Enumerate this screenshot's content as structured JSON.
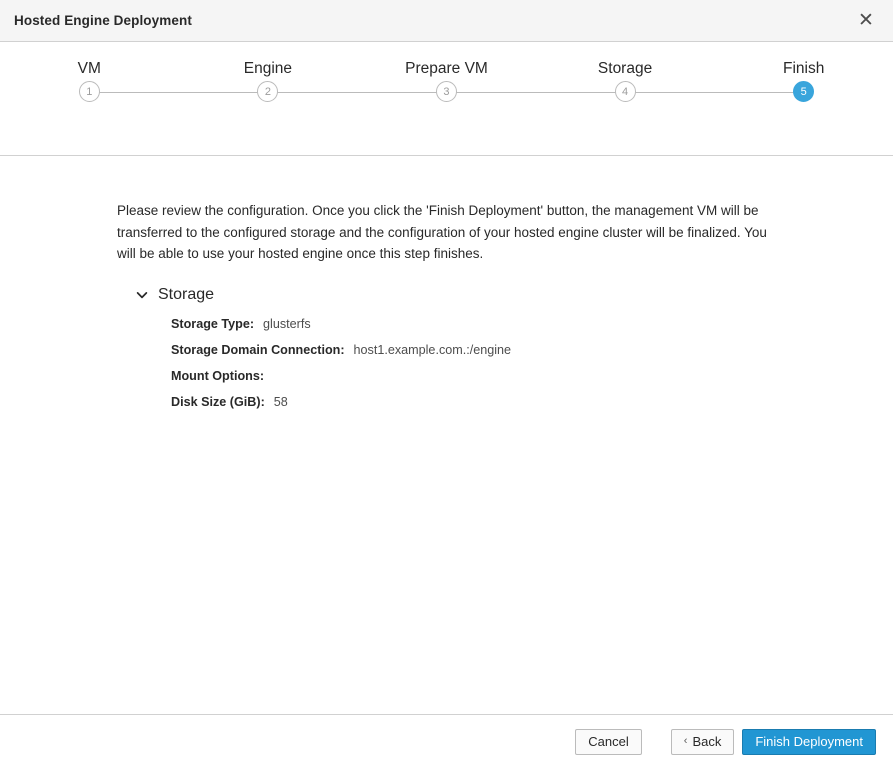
{
  "window": {
    "title": "Hosted Engine Deployment",
    "close_icon": "close-icon",
    "close_glyph": "✕"
  },
  "wizard": {
    "active_step": 5,
    "accent_color": "#39a5dc",
    "steps": [
      {
        "number": "1",
        "label": "VM"
      },
      {
        "number": "2",
        "label": "Engine"
      },
      {
        "number": "3",
        "label": "Prepare VM"
      },
      {
        "number": "4",
        "label": "Storage"
      },
      {
        "number": "5",
        "label": "Finish"
      }
    ]
  },
  "main": {
    "intro": "Please review the configuration. Once you click the 'Finish Deployment' button, the management VM will be transferred to the configured storage and the configuration of your hosted engine cluster will be finalized. You will be able to use your hosted engine once this step finishes.",
    "section": {
      "title": "Storage",
      "expanded": true,
      "toggle_icon": "chevron-down-icon",
      "rows": [
        {
          "label": "Storage Type:",
          "value": "glusterfs"
        },
        {
          "label": "Storage Domain Connection:",
          "value": "host1.example.com.:/engine"
        },
        {
          "label": "Mount Options:",
          "value": ""
        },
        {
          "label": "Disk Size (GiB):",
          "value": "58"
        }
      ]
    }
  },
  "footer": {
    "cancel_label": "Cancel",
    "back_label": "Back",
    "back_chevron": "‹",
    "finish_label": "Finish Deployment",
    "primary_color": "#2196d3"
  }
}
